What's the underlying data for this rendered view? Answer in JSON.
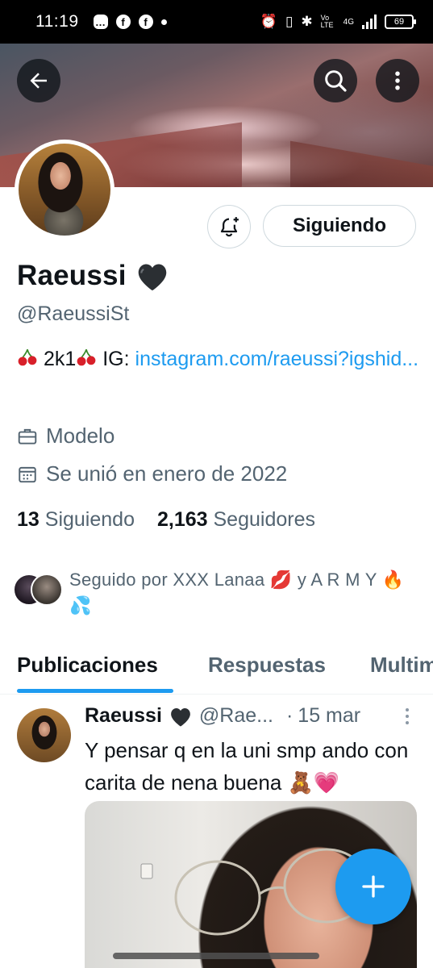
{
  "status_bar": {
    "time": "11:19",
    "volte": "Vo LTE",
    "network": "4G",
    "battery": "69"
  },
  "profile": {
    "display_name": "Raeussi",
    "handle": "@RaeussiSt",
    "bio_text": "2k1",
    "bio_ig_prefix": "IG:",
    "bio_link": "instagram.com/raeussi?igshid...",
    "occupation": "Modelo",
    "joined": "Se unió en enero de 2022",
    "following_count": "13",
    "following_label": "Siguiendo",
    "followers_count": "2,163",
    "followers_label": "Seguidores",
    "followed_by": "Seguido por XXX Lanaa 💋 y A R M Y 🔥💦"
  },
  "actions": {
    "follow_label": "Siguiendo"
  },
  "tabs": [
    {
      "label": "Publicaciones",
      "active": true
    },
    {
      "label": "Respuestas",
      "active": false
    },
    {
      "label": "Multim",
      "active": false
    }
  ],
  "post": {
    "name": "Raeussi",
    "handle": "@Rae...",
    "dot": "·",
    "date": "15 mar",
    "text": "Y pensar q en la uni smp ando con carita de nena buena 🧸💗"
  },
  "colors": {
    "accent": "#1d9bf0",
    "text_primary": "#0f1419",
    "text_secondary": "#536471"
  },
  "icons": [
    "back-arrow-icon",
    "search-icon",
    "more-vertical-icon",
    "bell-plus-icon",
    "briefcase-icon",
    "calendar-icon",
    "black-heart-icon",
    "cherry-icon",
    "plus-icon"
  ]
}
